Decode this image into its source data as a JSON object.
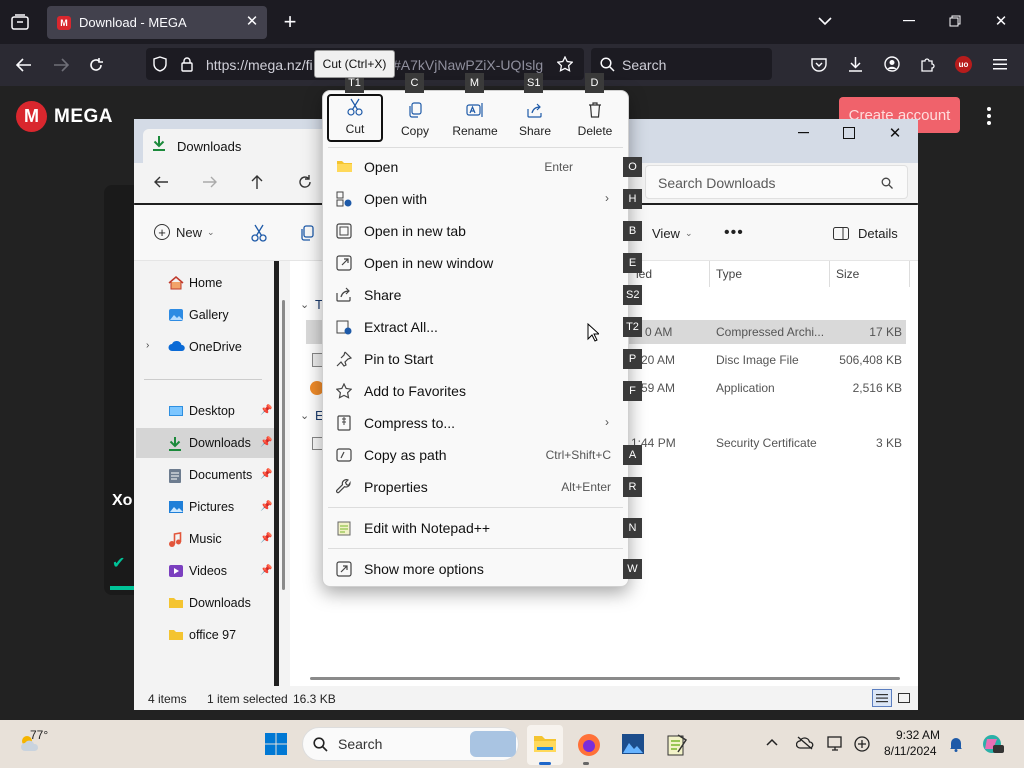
{
  "browser": {
    "tab_title": "Download - MEGA",
    "url_main": "https://mega.nz/fi",
    "url_tail": "#A7kVjNawPZiX-UQIslg",
    "search_placeholder": "Search",
    "tooltip": "Cut (Ctrl+X)"
  },
  "mega": {
    "logo_text": "MEGA",
    "logo_letter": "M",
    "create_account": "Create account",
    "side_text": "Xo"
  },
  "explorer": {
    "tab_title": "Downloads",
    "search_placeholder": "Search Downloads",
    "toolbar": {
      "new_label": "New",
      "view_label": "View",
      "details_label": "Details"
    },
    "nav": [
      {
        "label": "Home"
      },
      {
        "label": "Gallery"
      },
      {
        "label": "OneDrive"
      },
      {
        "label": "Desktop"
      },
      {
        "label": "Downloads"
      },
      {
        "label": "Documents"
      },
      {
        "label": "Pictures"
      },
      {
        "label": "Music"
      },
      {
        "label": "Videos"
      },
      {
        "label": "Downloads"
      },
      {
        "label": "office 97"
      }
    ],
    "columns": {
      "modified": "ied",
      "type": "Type",
      "size": "Size"
    },
    "group1": "T",
    "group2": "E",
    "rows": [
      {
        "time": "0 AM",
        "type": "Compressed Archi...",
        "size": "17 KB"
      },
      {
        "time": "20 AM",
        "type": "Disc Image File",
        "size": "506,408 KB"
      },
      {
        "time": "59 AM",
        "type": "Application",
        "size": "2,516 KB"
      },
      {
        "time": "1:44 PM",
        "type": "Security Certificate",
        "size": "3 KB"
      }
    ],
    "status": {
      "items": "4 items",
      "selected": "1 item selected",
      "size": "16.3 KB"
    }
  },
  "context_menu": {
    "quick_actions": [
      {
        "label": "Cut",
        "key": "T1"
      },
      {
        "label": "Copy",
        "key": "C"
      },
      {
        "label": "Rename",
        "key": "M"
      },
      {
        "label": "Share",
        "key": "S1"
      },
      {
        "label": "Delete",
        "key": "D"
      }
    ],
    "items": [
      {
        "label": "Open",
        "shortcut": "Enter",
        "key": "O"
      },
      {
        "label": "Open with",
        "shortcut": "",
        "key": "H"
      },
      {
        "label": "Open in new tab",
        "shortcut": "",
        "key": "B"
      },
      {
        "label": "Open in new window",
        "shortcut": "",
        "key": "E"
      },
      {
        "label": "Share",
        "shortcut": "",
        "key": "S2"
      },
      {
        "label": "Extract All...",
        "shortcut": "",
        "key": "T2"
      },
      {
        "label": "Pin to Start",
        "shortcut": "",
        "key": "P"
      },
      {
        "label": "Add to Favorites",
        "shortcut": "",
        "key": "F"
      },
      {
        "label": "Compress to...",
        "shortcut": "",
        "key": ""
      },
      {
        "label": "Copy as path",
        "shortcut": "Ctrl+Shift+C",
        "key": "A"
      },
      {
        "label": "Properties",
        "shortcut": "Alt+Enter",
        "key": "R"
      },
      {
        "label": "Edit with Notepad++",
        "shortcut": "",
        "key": "N"
      },
      {
        "label": "Show more options",
        "shortcut": "",
        "key": "W"
      }
    ]
  },
  "taskbar": {
    "temperature": "77°",
    "search_label": "Search",
    "time": "9:32 AM",
    "date": "8/11/2024"
  },
  "colors": {
    "mega_red": "#d9272e",
    "accent_blue": "#0067c0"
  }
}
